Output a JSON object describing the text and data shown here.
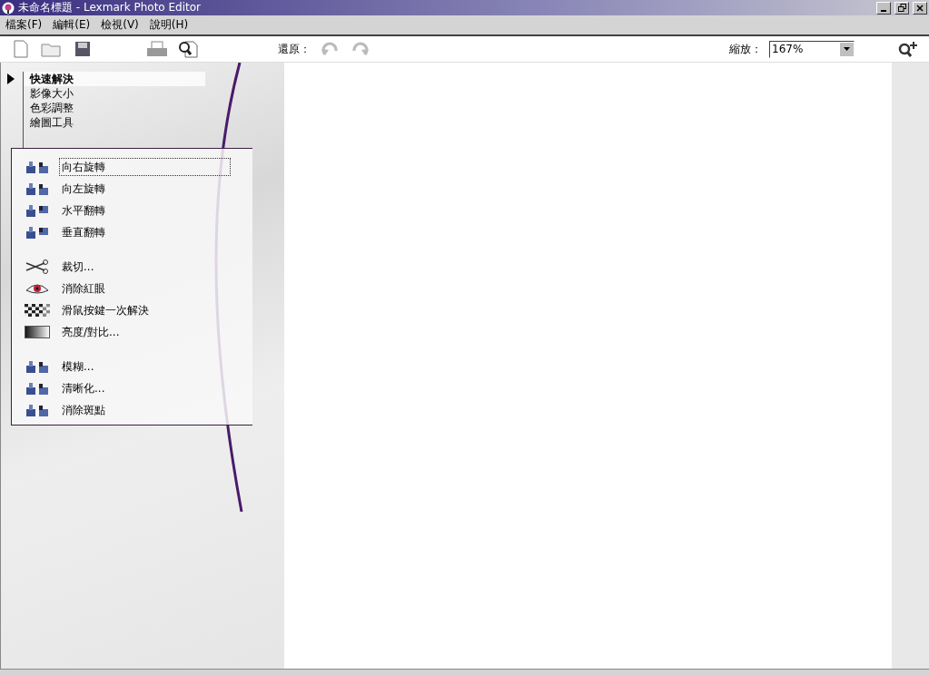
{
  "window": {
    "title": "未命名標題 - Lexmark Photo Editor"
  },
  "menu": [
    "檔案(F)",
    "編輯(E)",
    "檢視(V)",
    "說明(H)"
  ],
  "toolbar": {
    "undo_label": "還原：",
    "zoom_label": "縮放：",
    "zoom_value": "167%"
  },
  "nav": [
    {
      "label": "快速解決",
      "selected": true
    },
    {
      "label": "影像大小",
      "selected": false
    },
    {
      "label": "色彩調整",
      "selected": false
    },
    {
      "label": "繪圖工具",
      "selected": false
    }
  ],
  "tool_groups": [
    {
      "tools": [
        {
          "label": "向右旋轉",
          "kind": "rotate",
          "selected": true
        },
        {
          "label": "向左旋轉",
          "kind": "rotate",
          "selected": false
        },
        {
          "label": "水平翻轉",
          "kind": "flip",
          "selected": false
        },
        {
          "label": "垂直翻轉",
          "kind": "flip",
          "selected": false
        }
      ]
    },
    {
      "tools": [
        {
          "label": "裁切...",
          "kind": "scissors",
          "selected": false
        },
        {
          "label": "消除紅眼",
          "kind": "eye",
          "selected": false
        },
        {
          "label": "滑鼠按鍵一次解決",
          "kind": "checker",
          "selected": false
        },
        {
          "label": "亮度/對比...",
          "kind": "gradient",
          "selected": false
        }
      ]
    },
    {
      "tools": [
        {
          "label": "模糊...",
          "kind": "blocks",
          "selected": false
        },
        {
          "label": "清晰化...",
          "kind": "blocks",
          "selected": false
        },
        {
          "label": "消除斑點",
          "kind": "blocks",
          "selected": false
        }
      ]
    }
  ]
}
